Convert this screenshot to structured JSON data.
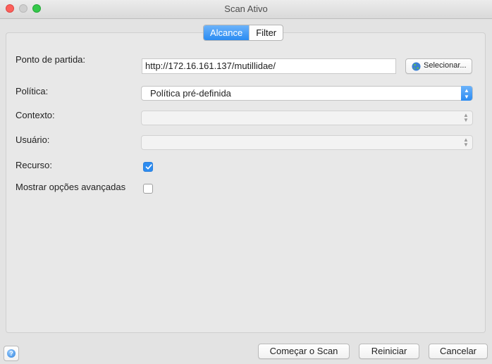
{
  "window": {
    "title": "Scan Ativo"
  },
  "tabs": [
    {
      "label": "Alcance",
      "active": true
    },
    {
      "label": "Filter",
      "active": false
    }
  ],
  "form": {
    "start_point": {
      "label": "Ponto de partida:",
      "value": "http://172.16.161.137/mutillidae/",
      "select_button": "Selecionar..."
    },
    "policy": {
      "label": "Política:",
      "value": "Política pré-definida"
    },
    "context": {
      "label": "Contexto:",
      "value": ""
    },
    "user": {
      "label": "Usuário:",
      "value": ""
    },
    "recurse": {
      "label": "Recurso:",
      "checked": true
    },
    "advanced": {
      "label": "Mostrar opções avançadas",
      "checked": false
    }
  },
  "footer": {
    "start_scan": "Começar o Scan",
    "reset": "Reiniciar",
    "cancel": "Cancelar",
    "help_icon": "?"
  },
  "colors": {
    "accent": "#2a8bf2",
    "close": "#fc605b",
    "maximize": "#34c84a"
  },
  "icons": {
    "globe": "globe-icon",
    "help": "help-icon",
    "check": "check-icon"
  }
}
